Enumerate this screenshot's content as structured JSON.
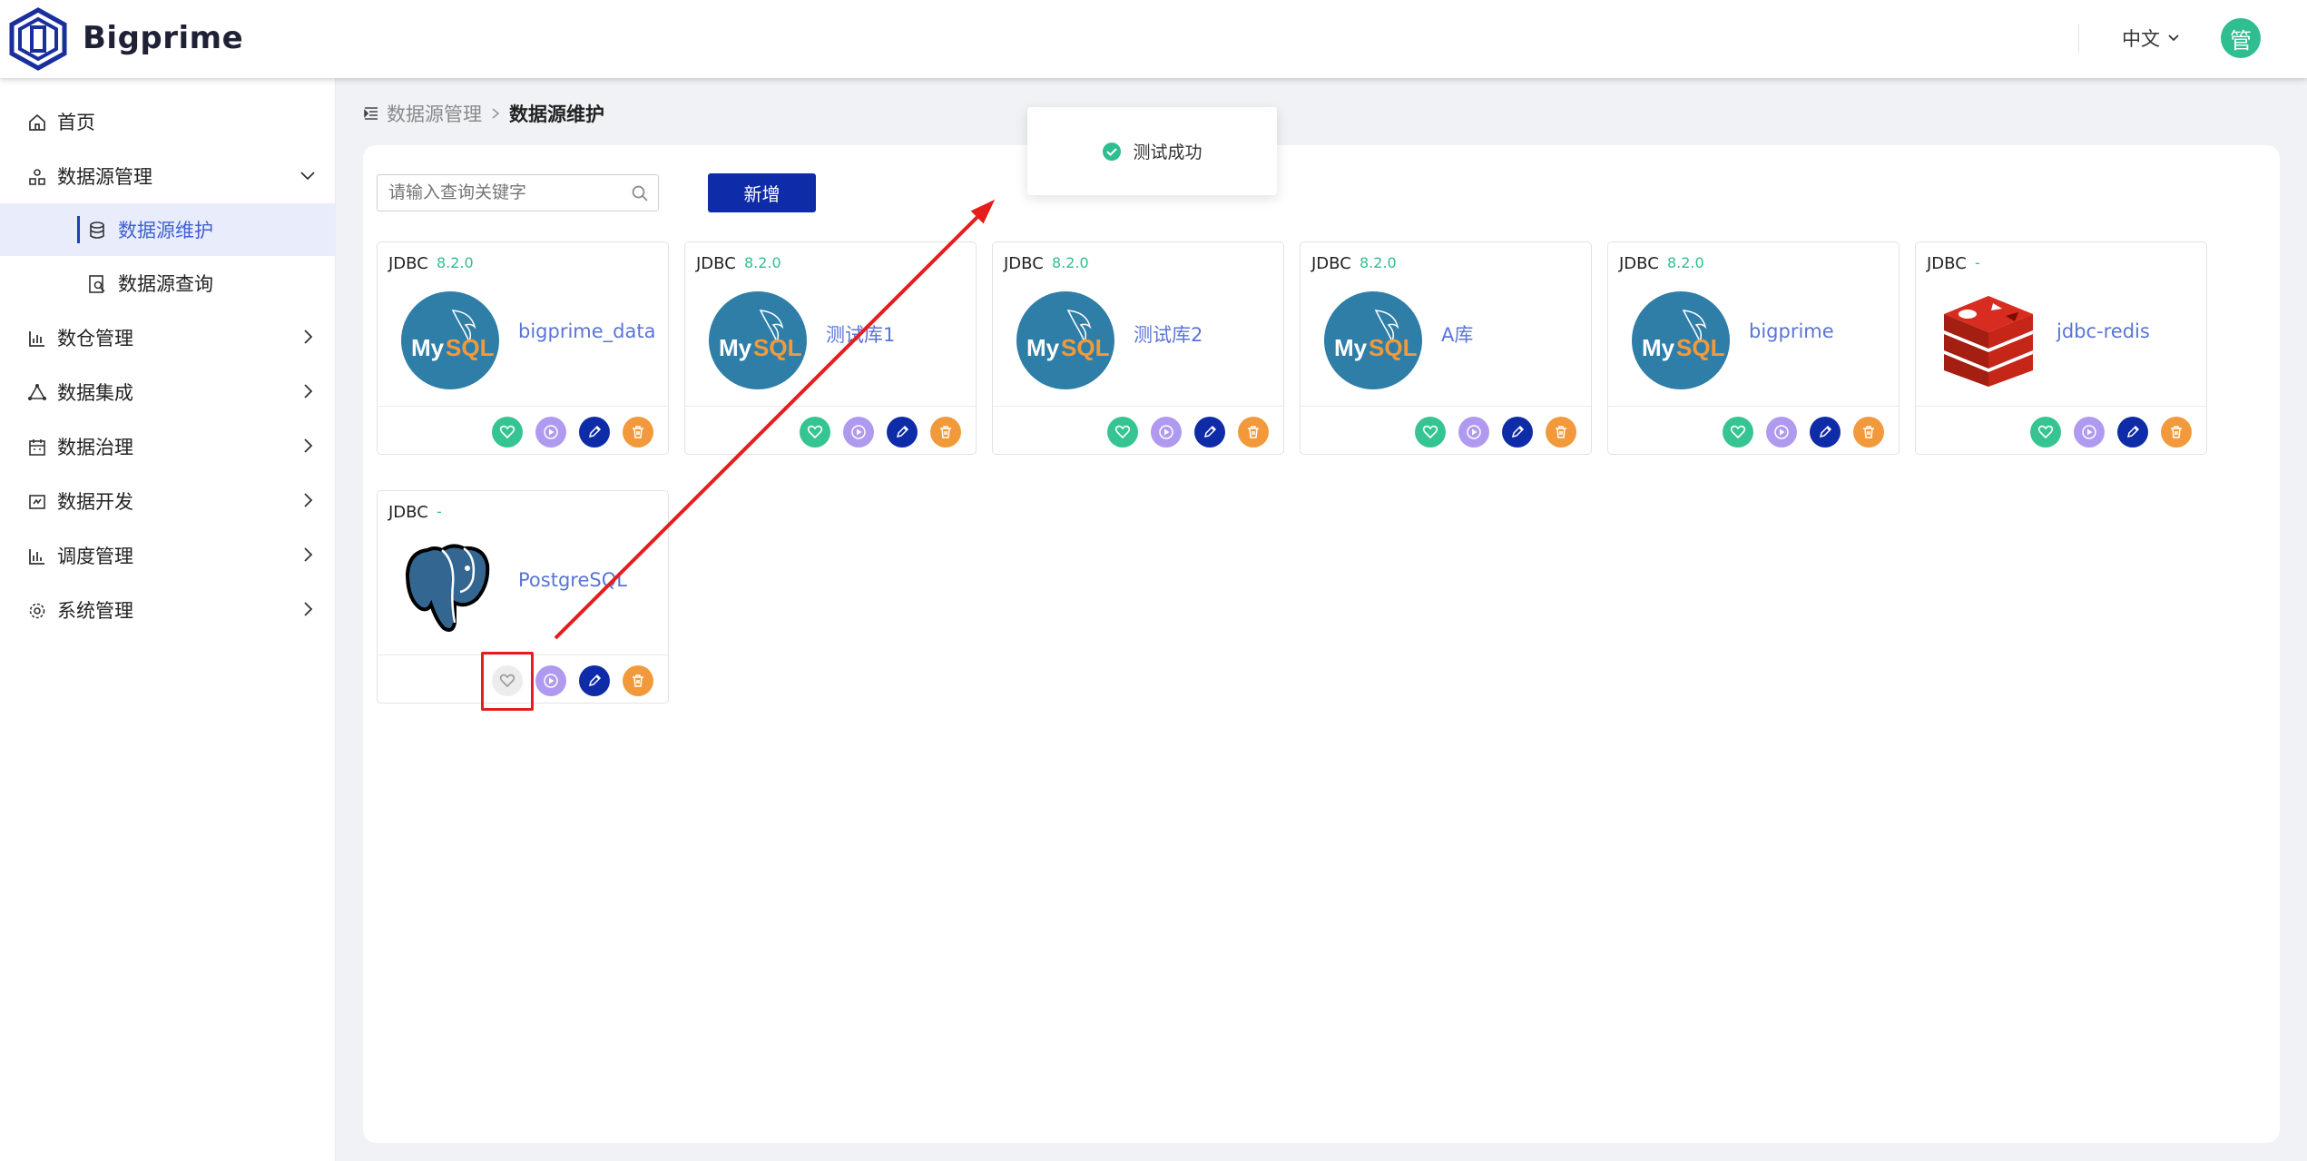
{
  "header": {
    "brand": "Bigprime",
    "language": "中文",
    "avatar_text": "管"
  },
  "sidebar": {
    "items": [
      {
        "label": "首页",
        "icon": "home-icon"
      },
      {
        "label": "数据源管理",
        "icon": "datasource-icon",
        "expanded": true
      },
      {
        "label": "数据源维护",
        "icon": "database-icon",
        "active": true
      },
      {
        "label": "数据源查询",
        "icon": "query-icon"
      },
      {
        "label": "数仓管理",
        "icon": "warehouse-icon"
      },
      {
        "label": "数据集成",
        "icon": "integration-icon"
      },
      {
        "label": "数据治理",
        "icon": "governance-icon"
      },
      {
        "label": "数据开发",
        "icon": "develop-icon"
      },
      {
        "label": "调度管理",
        "icon": "schedule-icon"
      },
      {
        "label": "系统管理",
        "icon": "settings-icon"
      }
    ]
  },
  "breadcrumb": {
    "parent": "数据源管理",
    "current": "数据源维护"
  },
  "toolbar": {
    "search_placeholder": "请输入查询关键字",
    "add_label": "新增"
  },
  "toast": {
    "message": "测试成功",
    "status": "success"
  },
  "cards": [
    {
      "type": "JDBC",
      "version": "8.2.0",
      "name": "bigprime_data",
      "logo": "mysql-logo",
      "favorite": true
    },
    {
      "type": "JDBC",
      "version": "8.2.0",
      "name": "测试库1",
      "logo": "mysql-logo",
      "favorite": true
    },
    {
      "type": "JDBC",
      "version": "8.2.0",
      "name": "测试库2",
      "logo": "mysql-logo",
      "favorite": true
    },
    {
      "type": "JDBC",
      "version": "8.2.0",
      "name": "A库",
      "logo": "mysql-logo",
      "favorite": true
    },
    {
      "type": "JDBC",
      "version": "8.2.0",
      "name": "bigprime",
      "logo": "mysql-logo",
      "favorite": true
    },
    {
      "type": "JDBC",
      "version": "-",
      "name": "jdbc-redis",
      "logo": "redis-logo",
      "favorite": true
    },
    {
      "type": "JDBC",
      "version": "-",
      "name": "PostgreSQL",
      "logo": "postgresql-logo",
      "favorite": false
    }
  ],
  "colors": {
    "primary": "#0f2ca8",
    "favorite": "#36c592",
    "test": "#b09af0",
    "delete": "#f29a3b",
    "link": "#5a74d6",
    "annotation": "#e51d1d"
  }
}
